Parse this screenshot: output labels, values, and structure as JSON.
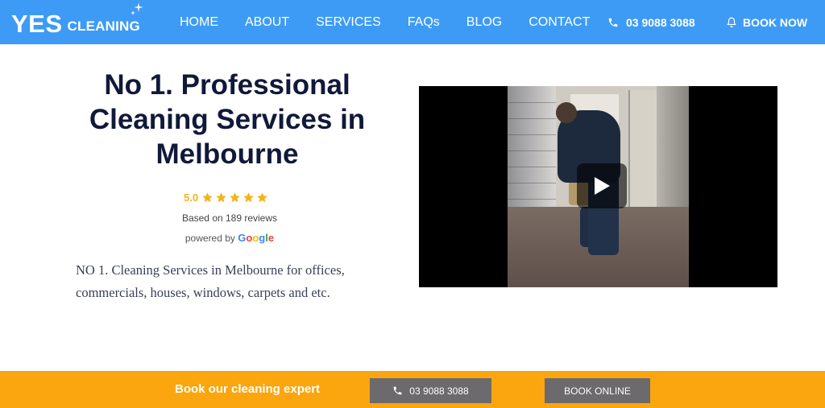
{
  "brand": {
    "logo_main": "YES",
    "logo_sub": "CLEANING",
    "primary_color": "#3d9bf5",
    "accent_color": "#fba50f"
  },
  "nav": {
    "items": [
      {
        "label": "HOME"
      },
      {
        "label": "ABOUT"
      },
      {
        "label": "SERVICES"
      },
      {
        "label": "FAQs"
      },
      {
        "label": "BLOG"
      },
      {
        "label": "CONTACT"
      }
    ],
    "phone": "03 9088 3088",
    "phone_icon": "phone-icon",
    "book_now": "BOOK NOW",
    "book_icon": "bell-icon"
  },
  "hero": {
    "title": "No 1. Professional Cleaning Services in Melbourne",
    "rating_score": "5.0",
    "stars": 5,
    "reviews_text": "Based on 189 reviews",
    "powered_by": "powered by",
    "google": "Google",
    "description": "NO 1. Cleaning Services in Melbourne for offices, commercials, houses, windows, carpets and etc."
  },
  "video": {
    "play_icon": "play-icon"
  },
  "bottom_bar": {
    "cta_text": "Book our cleaning expert",
    "call_label": "03 9088 3088",
    "book_label": "BOOK ONLINE"
  }
}
